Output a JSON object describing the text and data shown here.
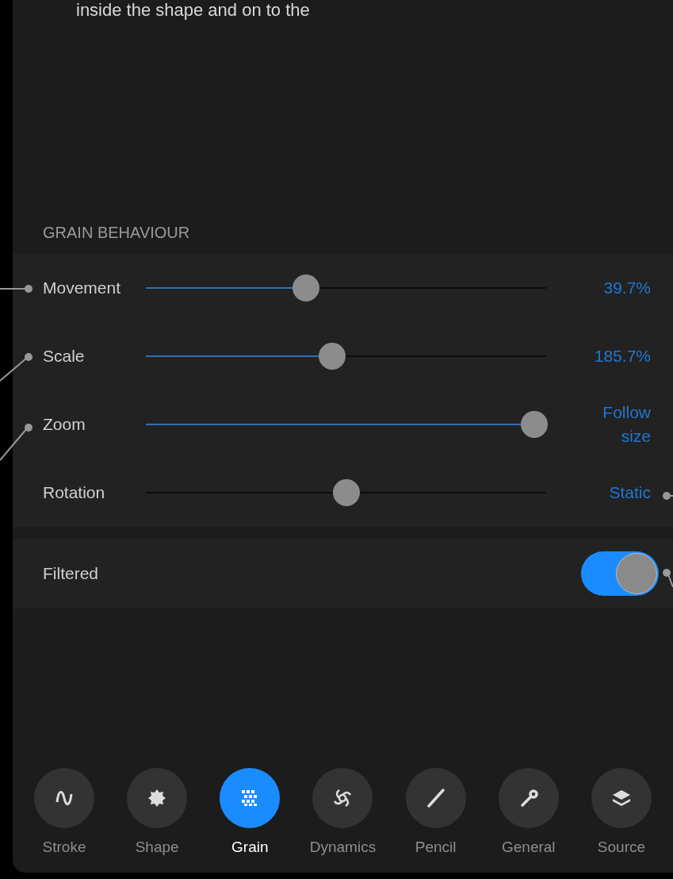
{
  "caption": "inside the shape and on to the",
  "section": {
    "title": "GRAIN BEHAVIOUR"
  },
  "sliders": [
    {
      "label": "Movement",
      "kind": "filled",
      "level": 0.4,
      "value": "39.7%"
    },
    {
      "label": "Scale",
      "kind": "filled",
      "level": 0.465,
      "value": "185.7%"
    },
    {
      "label": "Zoom",
      "kind": "filled",
      "level": 0.97,
      "value": "Follow size"
    },
    {
      "label": "Rotation",
      "kind": "centered",
      "level": 0.5,
      "value": "Static"
    }
  ],
  "toggle": {
    "label": "Filtered",
    "on": true
  },
  "tabs": [
    {
      "label": "Stroke",
      "kind": "stroke",
      "selected": false
    },
    {
      "label": "Shape",
      "kind": "shape",
      "selected": false
    },
    {
      "label": "Grain",
      "kind": "grain",
      "selected": true
    },
    {
      "label": "Dynamics",
      "kind": "dynamics",
      "selected": false
    },
    {
      "label": "Pencil",
      "kind": "pencil",
      "selected": false
    },
    {
      "label": "General",
      "kind": "general",
      "selected": false
    },
    {
      "label": "Source",
      "kind": "source",
      "selected": false
    }
  ]
}
